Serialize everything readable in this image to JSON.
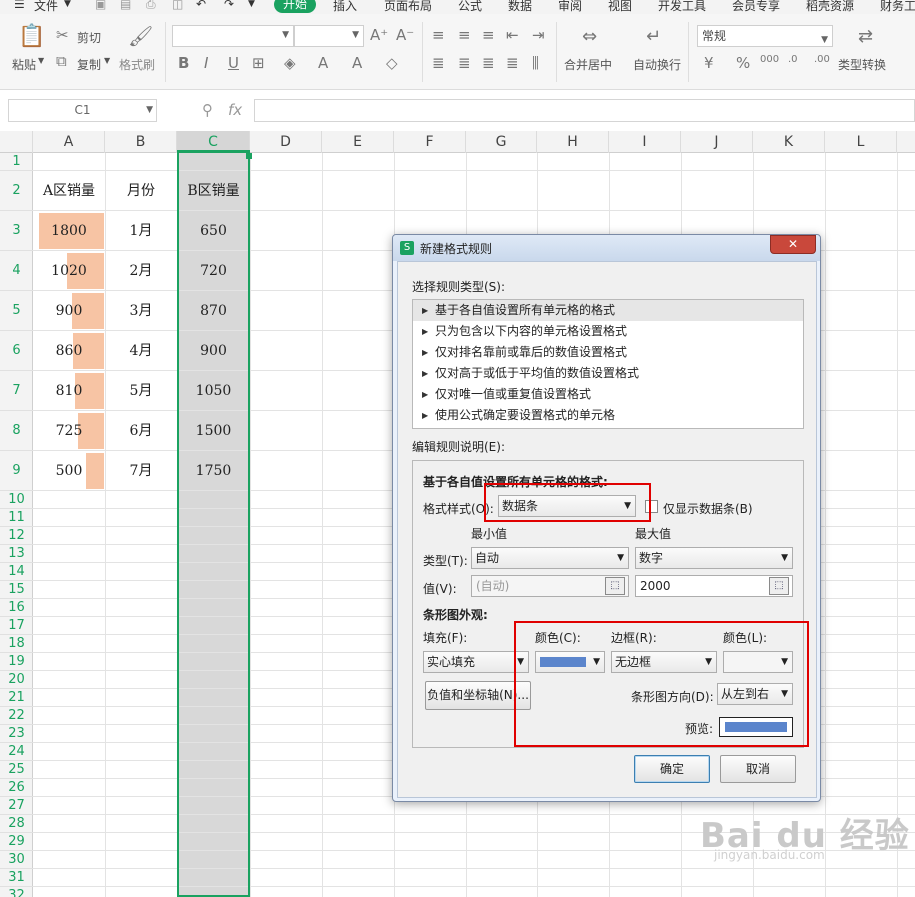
{
  "menu": {
    "file_label": "文件",
    "tabs": [
      "开始",
      "插入",
      "页面布局",
      "公式",
      "数据",
      "审阅",
      "视图",
      "开发工具",
      "会员专享",
      "稻壳资源",
      "财务工"
    ]
  },
  "ribbon": {
    "paste": "粘贴",
    "cut": "剪切",
    "copy": "复制",
    "format_painter": "格式刷",
    "merge": "合并居中",
    "wrap": "自动换行",
    "number_format": "常规",
    "convert": "类型转换"
  },
  "formula_bar": {
    "name_box": "C1",
    "fx": "fx"
  },
  "columns": [
    "A",
    "B",
    "C",
    "D",
    "E",
    "F",
    "G",
    "H",
    "I",
    "J",
    "K",
    "L"
  ],
  "rows": [
    "1",
    "2",
    "3",
    "4",
    "5",
    "6",
    "7",
    "8",
    "9",
    "10",
    "11",
    "12",
    "13",
    "14",
    "15",
    "16",
    "17",
    "18",
    "19",
    "20",
    "21",
    "22",
    "23",
    "24",
    "25",
    "26",
    "27",
    "28",
    "29",
    "30",
    "31",
    "32"
  ],
  "sheet": {
    "header_a": "A区销量",
    "header_b": "月份",
    "header_c": "B区销量",
    "data": [
      {
        "a": "1800",
        "b": "1月",
        "c": "650"
      },
      {
        "a": "1020",
        "b": "2月",
        "c": "720"
      },
      {
        "a": "900",
        "b": "3月",
        "c": "870"
      },
      {
        "a": "860",
        "b": "4月",
        "c": "900"
      },
      {
        "a": "810",
        "b": "5月",
        "c": "1050"
      },
      {
        "a": "725",
        "b": "6月",
        "c": "1500"
      },
      {
        "a": "500",
        "b": "7月",
        "c": "1750"
      }
    ],
    "bar_color": "#f7c4a4",
    "bar_max": 2000
  },
  "dialog": {
    "title": "新建格式规则",
    "close": "✕",
    "rule_type_label": "选择规则类型(S):",
    "rule_types": [
      "基于各自值设置所有单元格的格式",
      "只为包含以下内容的单元格设置格式",
      "仅对排名靠前或靠后的数值设置格式",
      "仅对高于或低于平均值的数值设置格式",
      "仅对唯一值或重复值设置格式",
      "使用公式确定要设置格式的单元格"
    ],
    "edit_label": "编辑规则说明(E):",
    "group_title": "基于各自值设置所有单元格的格式:",
    "format_style_label": "格式样式(O):",
    "format_style_value": "数据条",
    "show_bar_only": "仅显示数据条(B)",
    "min_label": "最小值",
    "max_label": "最大值",
    "type_label": "类型(T):",
    "min_type": "自动",
    "max_type": "数字",
    "value_label": "值(V):",
    "min_value": "(自动)",
    "max_value": "2000",
    "bar_appearance": "条形图外观:",
    "fill_label": "填充(F):",
    "fill_value": "实心填充",
    "color_label": "颜色(C):",
    "border_label": "边框(R):",
    "border_value": "无边框",
    "border_color_label": "颜色(L):",
    "neg_axis_button": "负值和坐标轴(N)...",
    "direction_label": "条形图方向(D):",
    "direction_value": "从左到右",
    "preview_label": "预览:",
    "ok": "确定",
    "cancel": "取消",
    "bar_fill_color": "#5b85cc"
  },
  "watermark": {
    "brand": "Bai du 经验",
    "url": "jingyan.baidu.com"
  }
}
